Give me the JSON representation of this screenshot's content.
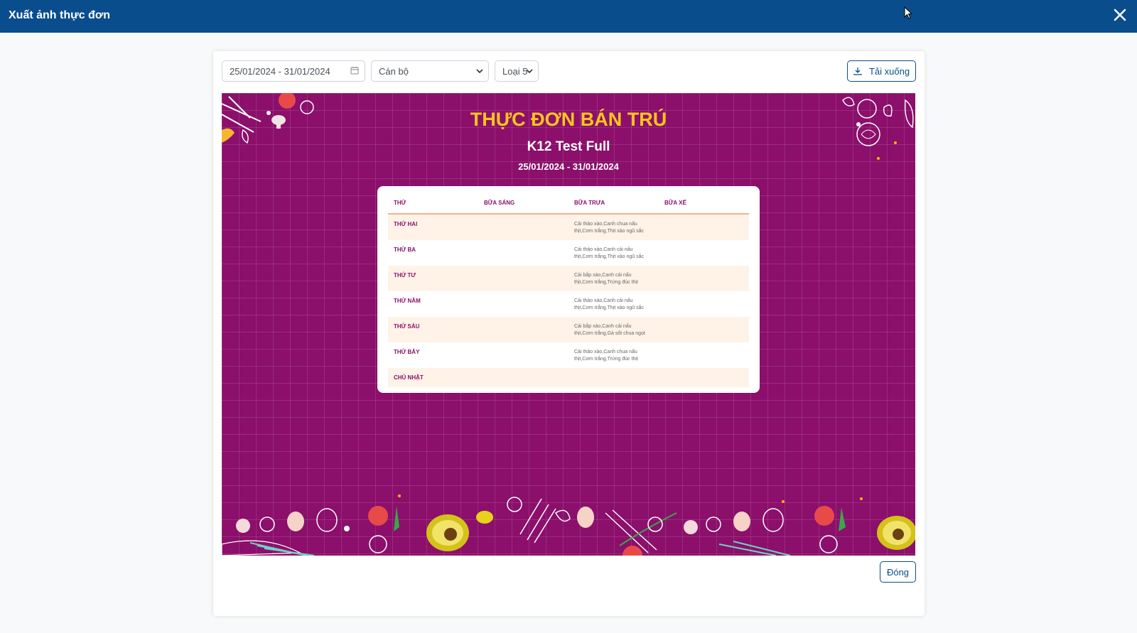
{
  "titlebar": {
    "title": "Xuất ảnh thực đơn"
  },
  "filters": {
    "date_range": "25/01/2024 - 31/01/2024",
    "audience": "Cán bộ",
    "type": "Loại 5"
  },
  "download_label": "Tải xuống",
  "close_label": "Đóng",
  "poster": {
    "title": "THỰC ĐƠN BÁN TRÚ",
    "school": "K12 Test Full",
    "date_range": "25/01/2024 - 31/01/2024",
    "headers": [
      "THỨ",
      "BỮA SÁNG",
      "BỮA TRƯA",
      "BỮA XẾ"
    ],
    "rows": [
      {
        "day": "THỨ HAI",
        "breakfast": "",
        "lunch_line1": "Cải thảo xào,Canh chua nấu",
        "lunch_line2": "thịt,Cơm trắng,Thịt xào ngũ sắc",
        "snack": ""
      },
      {
        "day": "THỨ BA",
        "breakfast": "",
        "lunch_line1": "Cải thảo xào,Canh cải nấu",
        "lunch_line2": "thịt,Cơm trắng,Thịt xào ngũ sắc",
        "snack": ""
      },
      {
        "day": "THỨ TƯ",
        "breakfast": "",
        "lunch_line1": "Cải bắp xào,Canh cải nấu",
        "lunch_line2": "thịt,Cơm trắng,Trứng đúc thịt",
        "snack": ""
      },
      {
        "day": "THỨ NĂM",
        "breakfast": "",
        "lunch_line1": "Cải thảo xào,Canh cải nấu",
        "lunch_line2": "thịt,Cơm trắng,Thịt xào ngũ sắc",
        "snack": ""
      },
      {
        "day": "THỨ SÁU",
        "breakfast": "",
        "lunch_line1": "Cải bắp xào,Canh cải nấu",
        "lunch_line2": "thịt,Cơm trắng,Gà sốt chua ngọt",
        "snack": ""
      },
      {
        "day": "THỨ BẢY",
        "breakfast": "",
        "lunch_line1": "Cải thảo xào,Canh chua nấu",
        "lunch_line2": "thịt,Cơm trắng,Trứng đúc thịt",
        "snack": ""
      },
      {
        "day": "CHỦ NHẬT",
        "breakfast": "",
        "lunch_line1": "",
        "lunch_line2": "",
        "snack": ""
      }
    ]
  },
  "colors": {
    "header_bg": "#0a4d8c",
    "poster_bg": "#8b0f6b",
    "poster_title": "#ffc61a",
    "row_alt": "#fff3e8"
  }
}
